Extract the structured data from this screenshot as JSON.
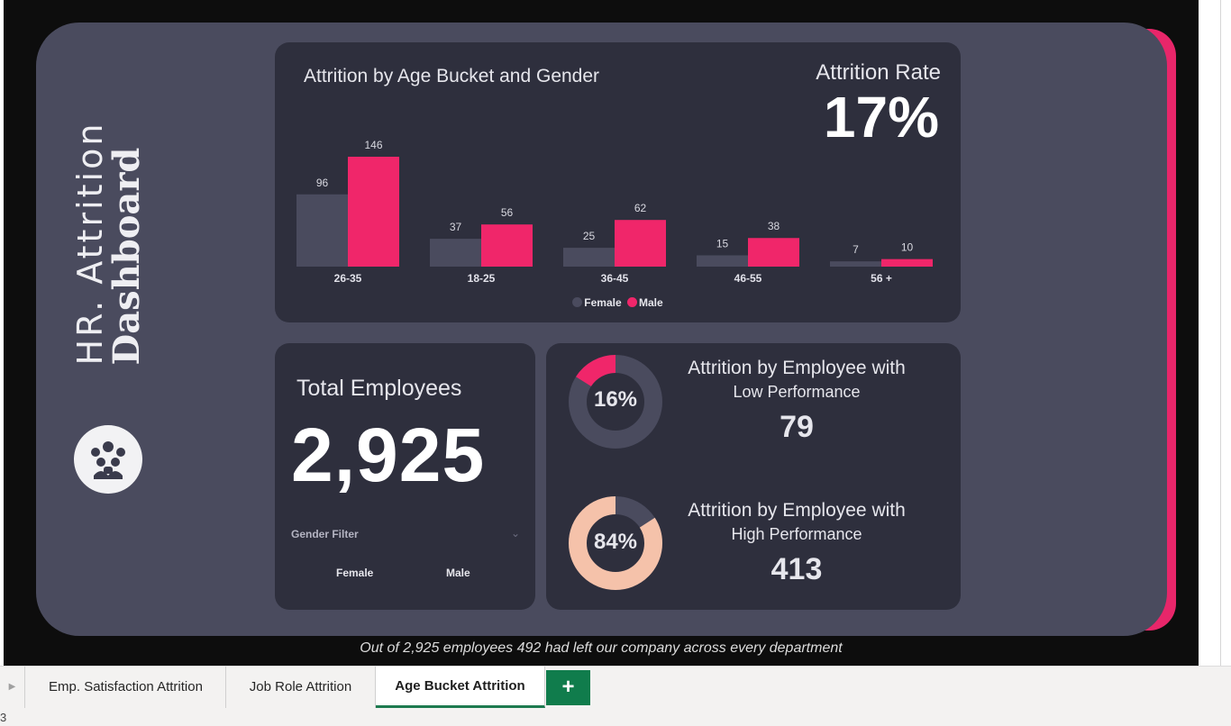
{
  "brand": {
    "line1": "HR. Attrition",
    "line2": "Dashboard",
    "logo_icon": "team-people-icon"
  },
  "age_panel": {
    "rate_label": "Attrition Rate",
    "rate_value": "17%"
  },
  "chart_data": {
    "type": "bar",
    "title": "Attrition by Age Bucket and Gender",
    "categories": [
      "26-35",
      "18-25",
      "36-45",
      "46-55",
      "56 +"
    ],
    "series": [
      {
        "name": "Female",
        "values": [
          96,
          37,
          25,
          15,
          7
        ],
        "color": "#4a4b5e"
      },
      {
        "name": "Male",
        "values": [
          146,
          56,
          62,
          38,
          10
        ],
        "color": "#f0266a"
      }
    ],
    "ylim": [
      0,
      146
    ],
    "grid": false,
    "legend": "bottom-center",
    "xlabel": "",
    "ylabel": ""
  },
  "total_panel": {
    "title": "Total Employees",
    "value": "2,925",
    "filter_label": "Gender Filter",
    "filter_options": [
      "Female",
      "Male"
    ]
  },
  "performance": {
    "low": {
      "title": "Attrition by Employee with",
      "subtitle": "Low Performance",
      "value": "79",
      "percent_label": "16%",
      "percent": 16,
      "color": "#f0266a",
      "rest_color": "#4a4b5e"
    },
    "high": {
      "title": "Attrition by Employee with",
      "subtitle": "High Performance",
      "value": "413",
      "percent_label": "84%",
      "percent": 84,
      "color": "#f5c2aa",
      "rest_color": "#4a4b5e"
    }
  },
  "caption": "Out of 2,925 employees 492 had left our company across every department",
  "tabs": [
    {
      "label": "Emp. Satisfaction Attrition",
      "active": false
    },
    {
      "label": "Job Role Attrition",
      "active": false
    },
    {
      "label": "Age Bucket Attrition",
      "active": true
    }
  ],
  "add_tab_label": "+",
  "status_text": "3"
}
